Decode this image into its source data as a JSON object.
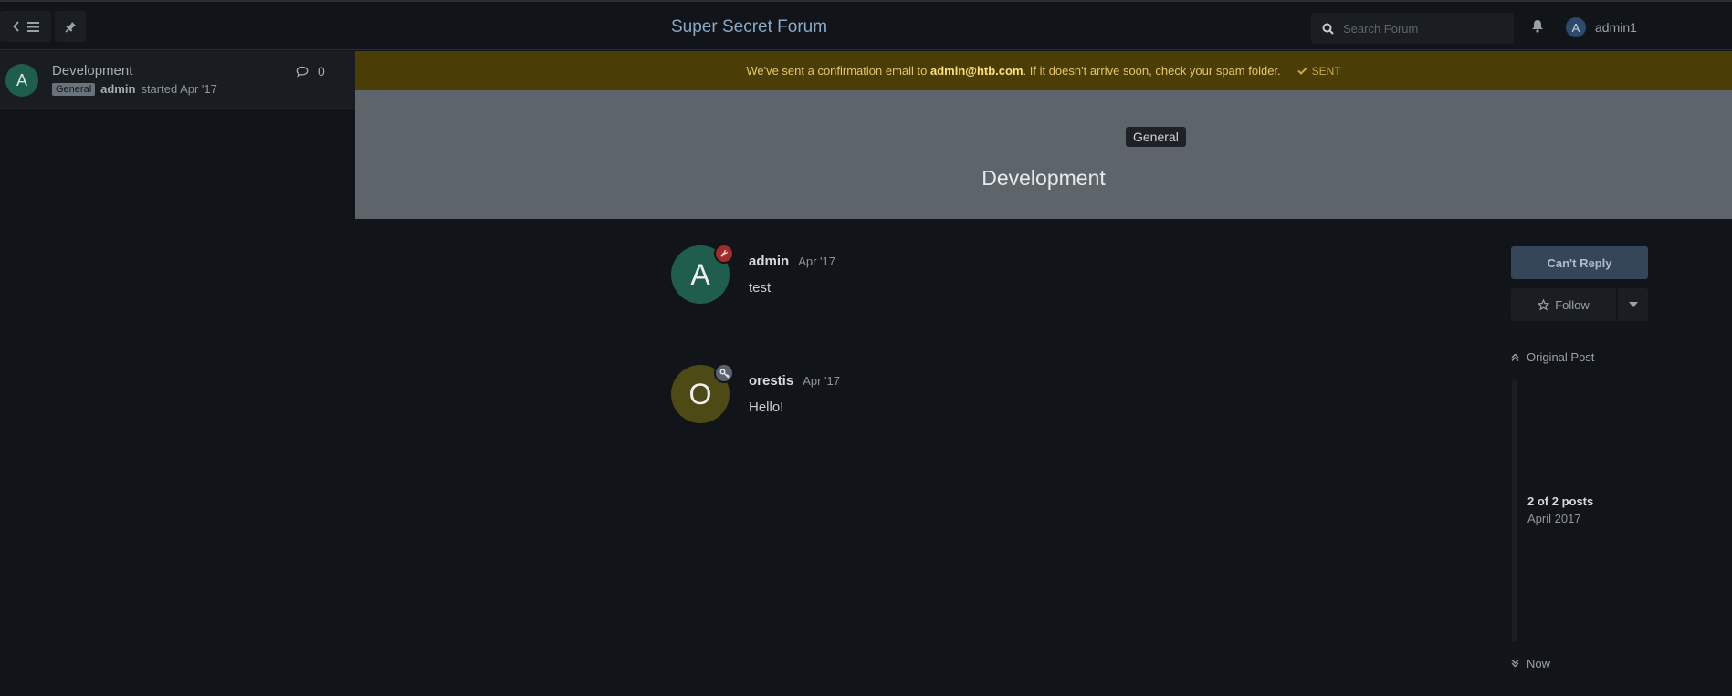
{
  "header": {
    "forum_title": "Super Secret Forum",
    "search_placeholder": "Search Forum",
    "username": "admin1",
    "user_initial": "A"
  },
  "sidebar": {
    "discussions": [
      {
        "initial": "A",
        "title": "Development",
        "tag": "General",
        "author": "admin",
        "started": "started Apr '17",
        "reply_count": "0"
      }
    ]
  },
  "alert": {
    "text_before": "We've sent a confirmation email to",
    "email": "admin@htb.com",
    "text_after": ". If it doesn't arrive soon, check your spam folder.",
    "status": "SENT",
    "background": "#4a3d05"
  },
  "hero": {
    "tag": "General",
    "title": "Development"
  },
  "posts": [
    {
      "initial": "A",
      "author": "admin",
      "date": "Apr '17",
      "body": "test",
      "avatar_color": "#1f5e4c",
      "badge_icon": "wrench-icon",
      "badge_color": "#a22c2c"
    },
    {
      "initial": "O",
      "author": "orestis",
      "date": "Apr '17",
      "body": "Hello!",
      "avatar_color": "#4e4a16",
      "badge_icon": "key-icon",
      "badge_color": "#5a6270"
    }
  ],
  "actions": {
    "reply_label": "Can't Reply",
    "follow_label": "Follow"
  },
  "scrubber": {
    "top_label": "Original Post",
    "position": "2 of 2 posts",
    "description": "April 2017",
    "bottom_label": "Now"
  }
}
